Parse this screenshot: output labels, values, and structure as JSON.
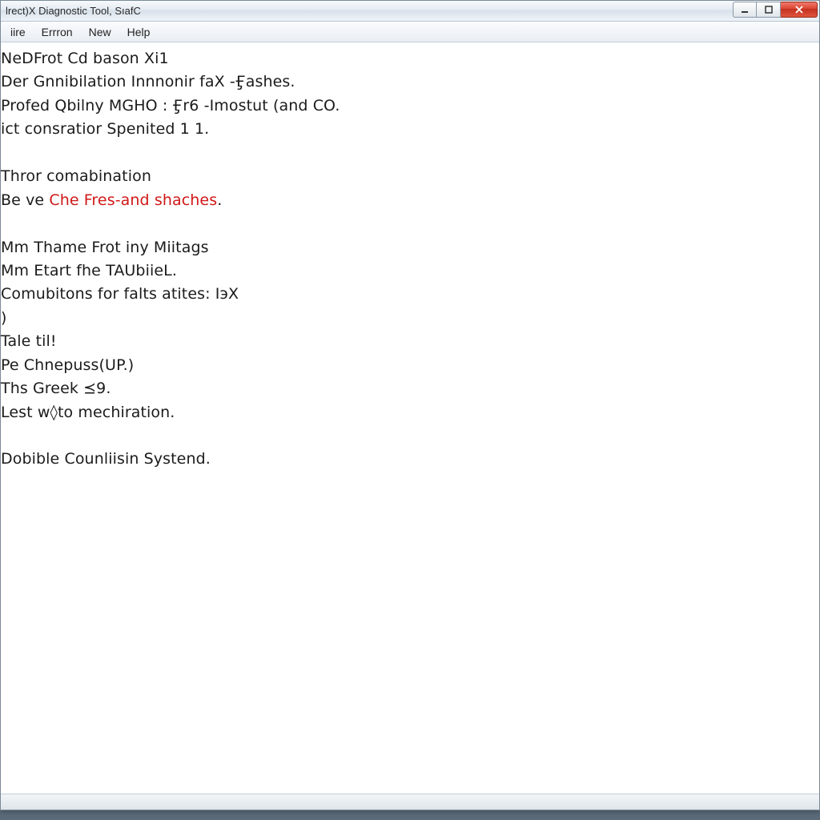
{
  "window": {
    "title": "lrect)X Diagnostic Tool, SıafC"
  },
  "menu": {
    "items": [
      "iire",
      "Errron",
      "New",
      "Help"
    ]
  },
  "content": {
    "lines": [
      {
        "text": "NeDFrot Cd bason Xi1"
      },
      {
        "text": "Der Gnnibilation Innnonir faX -Ӻashes."
      },
      {
        "text": "Profed Qbilny MGHO : Ӻr6 -Imostut (and CO."
      },
      {
        "text": "ict consratior Spenited 1 1."
      },
      {
        "text": ""
      },
      {
        "text": "Thror comabination"
      },
      {
        "prefix": "Be ve ",
        "red": "Che Fres-and shaches",
        "suffix": "."
      },
      {
        "text": ""
      },
      {
        "text": "Mm Thame Frot iny Miitags"
      },
      {
        "text": "Mm Etart fhe TAUbiieL."
      },
      {
        "text": "Comubitons for falts atites: IэX"
      },
      {
        "text": ")"
      },
      {
        "text": "Tale til!"
      },
      {
        "text": "Pe Chnepuss(UP.)"
      },
      {
        "text": "Ths Greek ⪯9."
      },
      {
        "text": "Lest w◊to mechiration."
      },
      {
        "text": ""
      },
      {
        "text": "Dobible Counliisin Systend."
      }
    ]
  },
  "icons": {
    "minimize": "minimize-icon",
    "maximize": "maximize-icon",
    "close": "close-icon"
  }
}
